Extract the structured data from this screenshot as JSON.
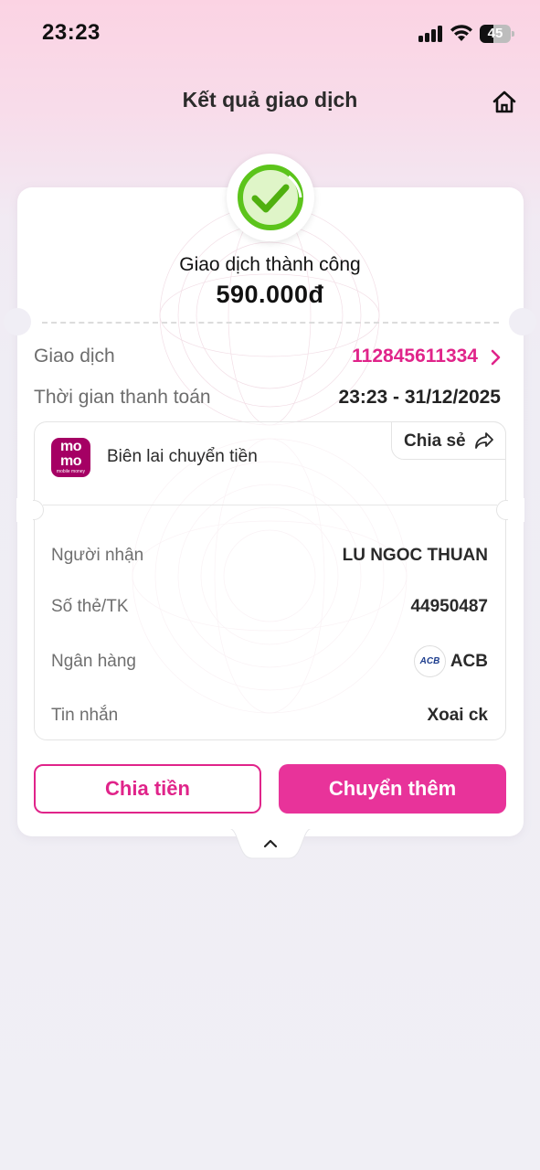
{
  "status_bar": {
    "time": "23:23",
    "battery": "45",
    "battery_level": 0.45
  },
  "header": {
    "title": "Kết quả giao dịch",
    "home_icon": "home-icon"
  },
  "result": {
    "status": "Giao dịch thành công",
    "amount": "590.000đ",
    "status_icon": "check-circle-icon",
    "success_color": "#5cc41b"
  },
  "summary": {
    "transaction_label": "Giao dịch",
    "transaction_id": "112845611334",
    "time_label": "Thời gian thanh toán",
    "time_value": "23:23 - 31/12/2025"
  },
  "receipt": {
    "logo": {
      "line1": "mo",
      "line2": "mo",
      "tagline": "mobile money"
    },
    "title": "Biên lai chuyển tiền",
    "share_label": "Chia sẻ",
    "share_icon": "share-arrow-icon",
    "details": [
      {
        "label": "Người nhận",
        "value": "LU NGOC THUAN"
      },
      {
        "label": "Số thẻ/TK",
        "value": "44950487"
      },
      {
        "label": "Ngân hàng",
        "value": "ACB",
        "bank_logo": "ACB"
      },
      {
        "label": "Tin nhắn",
        "value": "Xoai ck"
      }
    ]
  },
  "actions": {
    "split_label": "Chia tiền",
    "transfer_more_label": "Chuyển thêm"
  },
  "colors": {
    "brand_pink": "#e8339a",
    "accent_pink": "#e0248a",
    "momo": "#a50064"
  },
  "expand_icon": "chevron-up-icon"
}
